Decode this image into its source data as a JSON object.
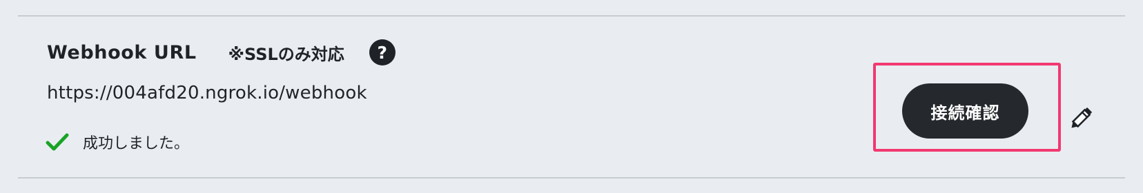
{
  "setting": {
    "title": "Webhook URL",
    "note": "※SSLのみ対応",
    "help_icon": "question-mark-icon",
    "help_glyph": "?",
    "url": "https://004afd20.ngrok.io/webhook",
    "status_icon": "checkmark-icon",
    "status_text": "成功しました。",
    "confirm_button_label": "接続確認",
    "edit_icon": "pencil-icon"
  },
  "colors": {
    "background": "#e9edf2",
    "button": "#25282c",
    "highlight": "#f2386f",
    "success": "#1aa326"
  }
}
